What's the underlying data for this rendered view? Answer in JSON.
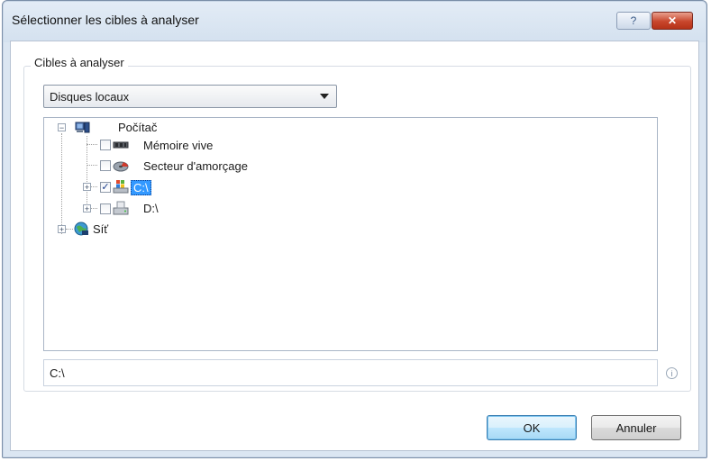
{
  "window": {
    "title": "Sélectionner les cibles à analyser",
    "help_glyph": "?",
    "close_glyph": "✕"
  },
  "group": {
    "label": "Cibles à analyser"
  },
  "target_combo": {
    "selected": "Disques locaux"
  },
  "tree": {
    "root": {
      "label": "Počítač",
      "expander": "−"
    },
    "children": [
      {
        "label": "Mémoire vive",
        "checked": false
      },
      {
        "label": "Secteur d'amorçage",
        "checked": false
      },
      {
        "label": "C:\\",
        "checked": true,
        "selected": true,
        "expander": "+"
      },
      {
        "label": "D:\\",
        "checked": false,
        "expander": "+"
      }
    ],
    "network": {
      "label": "Síť",
      "expander": "+"
    }
  },
  "path_field": {
    "value": "C:\\"
  },
  "info_glyph": "i",
  "buttons": {
    "ok": "OK",
    "cancel": "Annuler"
  }
}
